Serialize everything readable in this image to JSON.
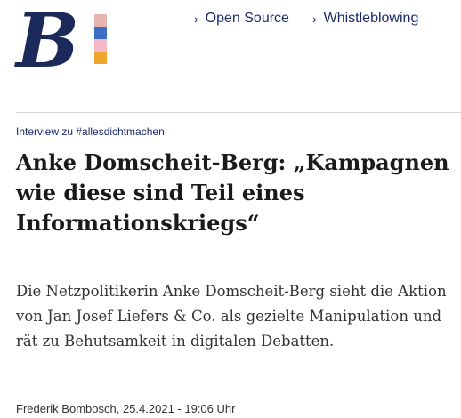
{
  "brand": {
    "logo_letter": "B",
    "logo_color": "#1b2a5a",
    "swatch_colors": [
      "#e8b4b0",
      "#3b6fc4",
      "#f3b9c6",
      "#efa62c"
    ]
  },
  "nav": {
    "items": [
      {
        "label": "Open Source",
        "icon": "chevron-right-icon"
      },
      {
        "label": "Whistleblowing",
        "icon": "chevron-right-icon"
      }
    ],
    "chevron": "›"
  },
  "article": {
    "kicker": "Interview zu #allesdichtmachen",
    "title": "Anke Domscheit-Berg: „Kampagnen wie diese sind Teil eines Informationskriegs“",
    "lead": "Die Netzpolitikerin Anke Domscheit-Berg sieht die Aktion von Jan Josef Liefers & Co. als gezielte Manipulation und rät zu Behutsamkeit in digitalen Debatten.",
    "author": "Frederik Bombosch",
    "separator": ",",
    "datetime": "25.4.2021 - 19:06 Uhr"
  },
  "colors": {
    "accent": "#1b2a6b",
    "text": "#1a1a1a",
    "divider": "#d6d6d6"
  }
}
